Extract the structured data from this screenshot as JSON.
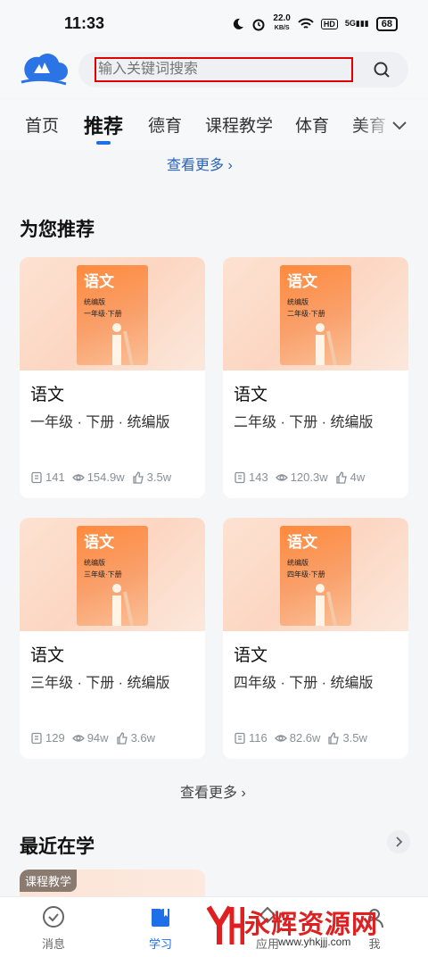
{
  "status_bar": {
    "time": "11:33",
    "speed_value": "22.0",
    "speed_unit": "KB/S",
    "hd": "HD",
    "network": "5G",
    "battery": "68"
  },
  "search": {
    "placeholder": "输入关键词搜索"
  },
  "tabs": [
    {
      "label": "首页"
    },
    {
      "label": "推荐"
    },
    {
      "label": "德育"
    },
    {
      "label": "课程教学"
    },
    {
      "label": "体育"
    },
    {
      "label": "美育"
    }
  ],
  "content": {
    "see_more_top": "查看更多 ›",
    "recommend_title": "为您推荐",
    "cards": [
      {
        "cover_title": "语文",
        "cover_edition": "统编版",
        "cover_grade": "一年级·下册",
        "title": "语文",
        "meta": "一年级 · 下册 · 统编版",
        "lessons": "141",
        "views": "154.9w",
        "likes": "3.5w"
      },
      {
        "cover_title": "语文",
        "cover_edition": "统编版",
        "cover_grade": "二年级·下册",
        "title": "语文",
        "meta": "二年级 · 下册 · 统编版",
        "lessons": "143",
        "views": "120.3w",
        "likes": "4w"
      },
      {
        "cover_title": "语文",
        "cover_edition": "统编版",
        "cover_grade": "三年级·下册",
        "title": "语文",
        "meta": "三年级 · 下册 · 统编版",
        "lessons": "129",
        "views": "94w",
        "likes": "3.6w"
      },
      {
        "cover_title": "语文",
        "cover_edition": "统编版",
        "cover_grade": "四年级·下册",
        "title": "语文",
        "meta": "四年级 · 下册 · 统编版",
        "lessons": "116",
        "views": "82.6w",
        "likes": "3.5w"
      }
    ],
    "see_more_mid": "查看更多 ›",
    "recent_title": "最近在学",
    "recent_badge": "课程教学"
  },
  "bottom_nav": [
    {
      "label": "消息",
      "icon": "message-check-icon"
    },
    {
      "label": "学习",
      "icon": "book-icon"
    },
    {
      "label": "应用",
      "icon": "apps-icon"
    },
    {
      "label": "我",
      "icon": "user-icon"
    }
  ],
  "watermark": {
    "text": "永辉资源网",
    "url": "www.yhkjjj.com"
  },
  "colors": {
    "accent": "#1e6fe8",
    "search_highlight": "#e00000",
    "cover_orange": "#ff8a3d"
  }
}
